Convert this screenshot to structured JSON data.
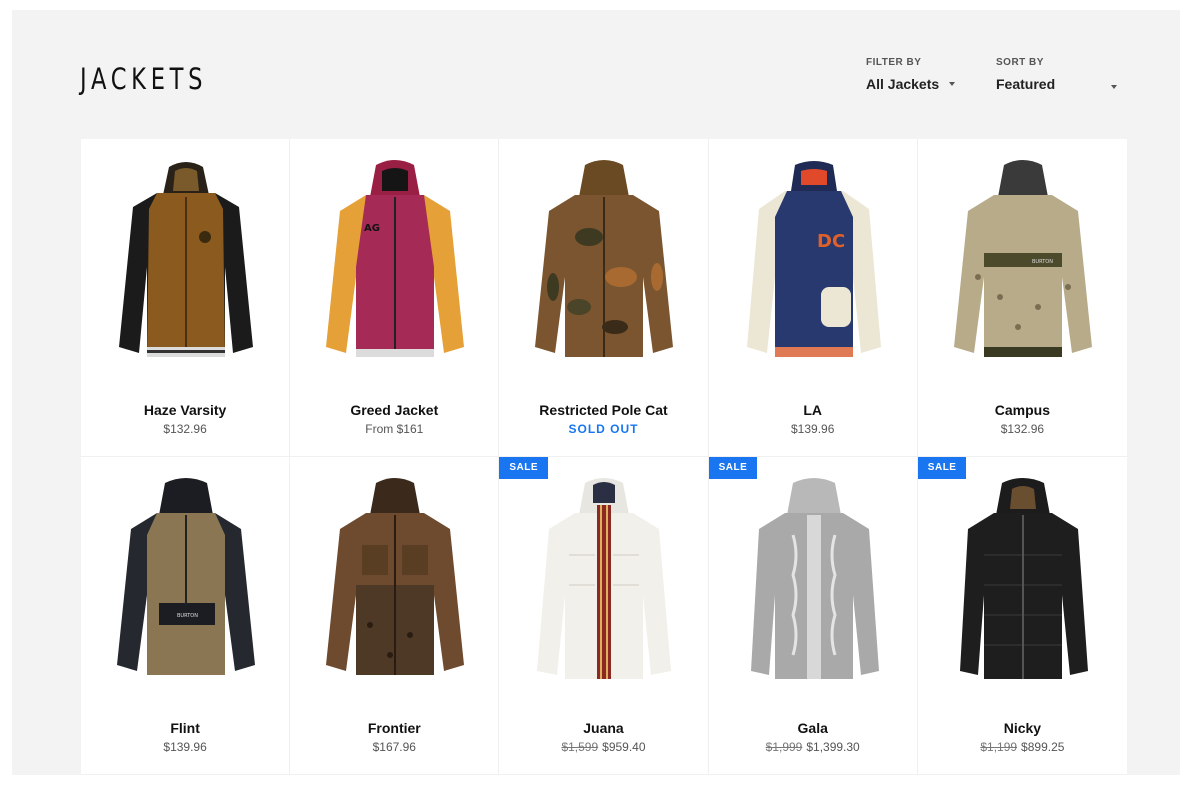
{
  "page": {
    "title": "JACKETS"
  },
  "filter": {
    "label": "FILTER BY",
    "value": "All Jackets"
  },
  "sort": {
    "label": "SORT BY",
    "value": "Featured"
  },
  "colors": {
    "accent": "#1976f0",
    "background": "#f3f3f3"
  },
  "products": [
    {
      "name": "Haze Varsity",
      "price": "$132.96",
      "image": "brown-jacket-black-sleeves"
    },
    {
      "name": "Greed Jacket",
      "price": "From $161",
      "image": "maroon-yellow-jacket"
    },
    {
      "name": "Restricted Pole Cat",
      "price": "SOLD OUT",
      "image": "camo-jacket"
    },
    {
      "name": "LA",
      "price": "$139.96",
      "image": "navy-cream-varsity-jacket"
    },
    {
      "name": "Campus",
      "price": "$132.96",
      "image": "beige-print-jacket"
    },
    {
      "name": "Flint",
      "price": "$139.96",
      "image": "tan-anorak-black-sleeves"
    },
    {
      "name": "Frontier",
      "price": "$167.96",
      "image": "brown-leopard-jacket"
    },
    {
      "name": "Juana",
      "badge": "SALE",
      "old_price": "$1,599",
      "price": "$959.40",
      "image": "white-puffer-stripe"
    },
    {
      "name": "Gala",
      "badge": "SALE",
      "old_price": "$1,999",
      "price": "$1,399.30",
      "image": "grey-knit-jacket"
    },
    {
      "name": "Nicky",
      "badge": "SALE",
      "old_price": "$1,199",
      "price": "$899.25",
      "image": "black-quilted-jacket"
    }
  ]
}
